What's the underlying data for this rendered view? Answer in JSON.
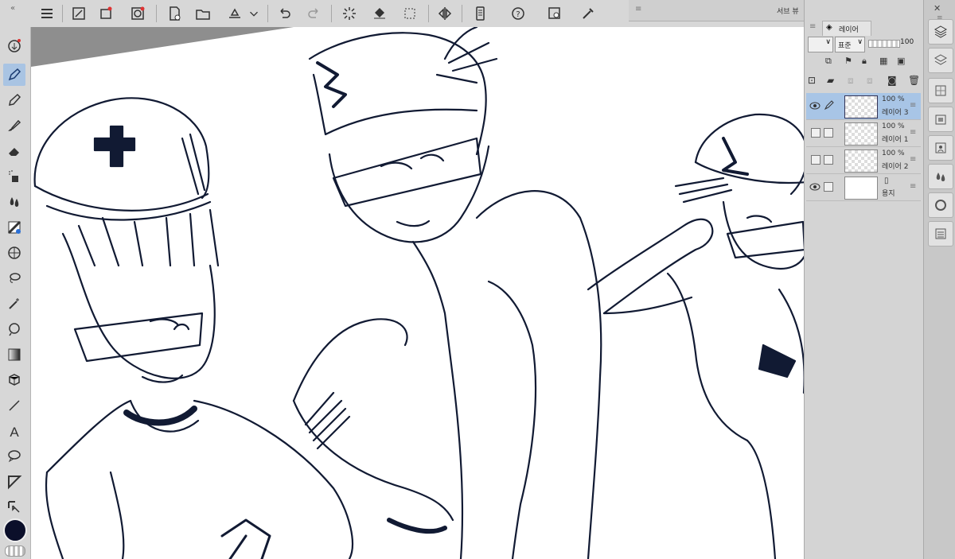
{
  "subview": {
    "title": "서브 뷰"
  },
  "layer_panel": {
    "tab_label": "레이어",
    "blend_mode": "표준",
    "opacity_value": "100",
    "layers": [
      {
        "name": "레이어 3",
        "opacity": "100 %",
        "selected": true,
        "visible": true
      },
      {
        "name": "레이어 1",
        "opacity": "100 %",
        "selected": false,
        "visible": false
      },
      {
        "name": "레이어 2",
        "opacity": "100 %",
        "selected": false,
        "visible": false
      },
      {
        "name": "용지",
        "opacity": "",
        "selected": false,
        "visible": true
      }
    ]
  },
  "colors": {
    "main_color": "#0b0f2a",
    "selection": "#a8c5e6",
    "ink": "#111a33"
  }
}
